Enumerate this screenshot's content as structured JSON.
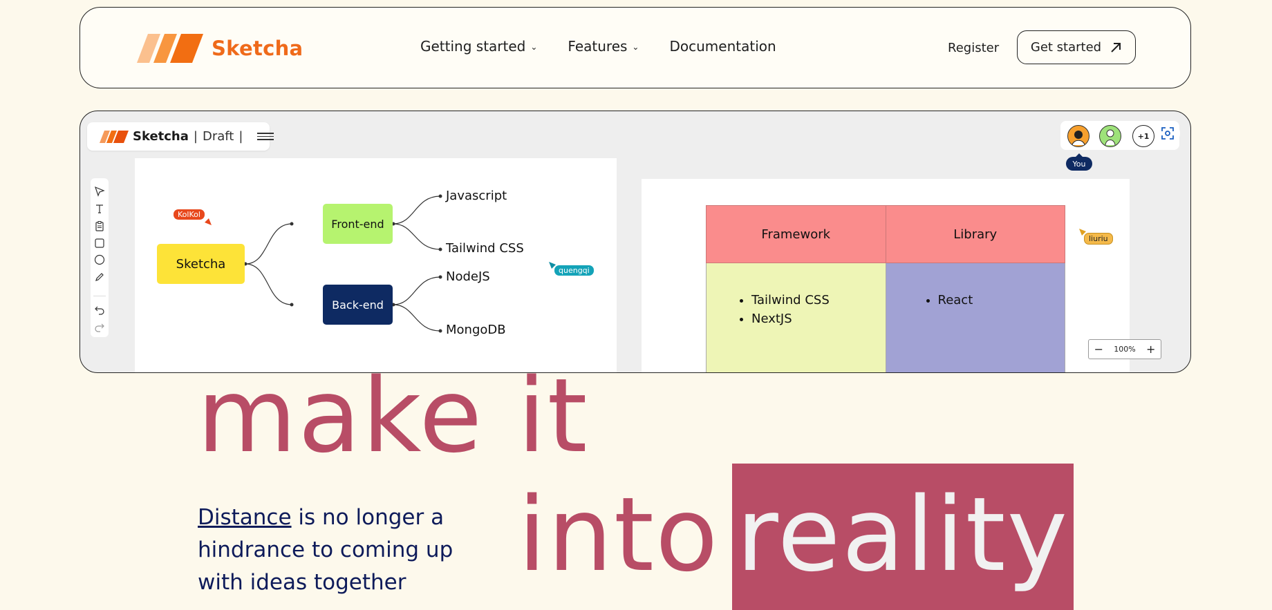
{
  "navbar": {
    "brand": "Sketcha",
    "links": [
      {
        "label": "Getting started",
        "has_dropdown": true
      },
      {
        "label": "Features",
        "has_dropdown": true
      },
      {
        "label": "Documentation",
        "has_dropdown": false
      }
    ],
    "register": "Register",
    "cta": "Get started",
    "brand_color": "#ef6a1a"
  },
  "app": {
    "brand": "Sketcha",
    "separator": "|",
    "doc_state": "Draft",
    "mindmap": {
      "root": "Sketcha",
      "branches": [
        {
          "label": "Front-end",
          "children": [
            "Javascript",
            "Tailwind CSS"
          ]
        },
        {
          "label": "Back-end",
          "children": [
            "NodeJS",
            "MongoDB"
          ]
        }
      ]
    },
    "cursors": {
      "kolkol": "KolKol",
      "quengqi": "quengqi",
      "liuriu": "liuriu"
    },
    "table": {
      "headers": [
        "Framework",
        "Library"
      ],
      "framework_items": [
        "Tailwind CSS",
        "NextJS"
      ],
      "library_items": [
        "React"
      ]
    },
    "collaborators": {
      "extra_count": "+1",
      "you_label": "You"
    },
    "zoom": {
      "level": "100%",
      "minus": "−",
      "plus": "+"
    }
  },
  "hero": {
    "line1": "make it",
    "line2": "into",
    "highlight": "reality",
    "sub_link": "Distance",
    "sub_rest": " is no longer a hindrance to coming up with ideas together",
    "accent": "#b84d66",
    "sub_color": "#0e1b5a"
  }
}
